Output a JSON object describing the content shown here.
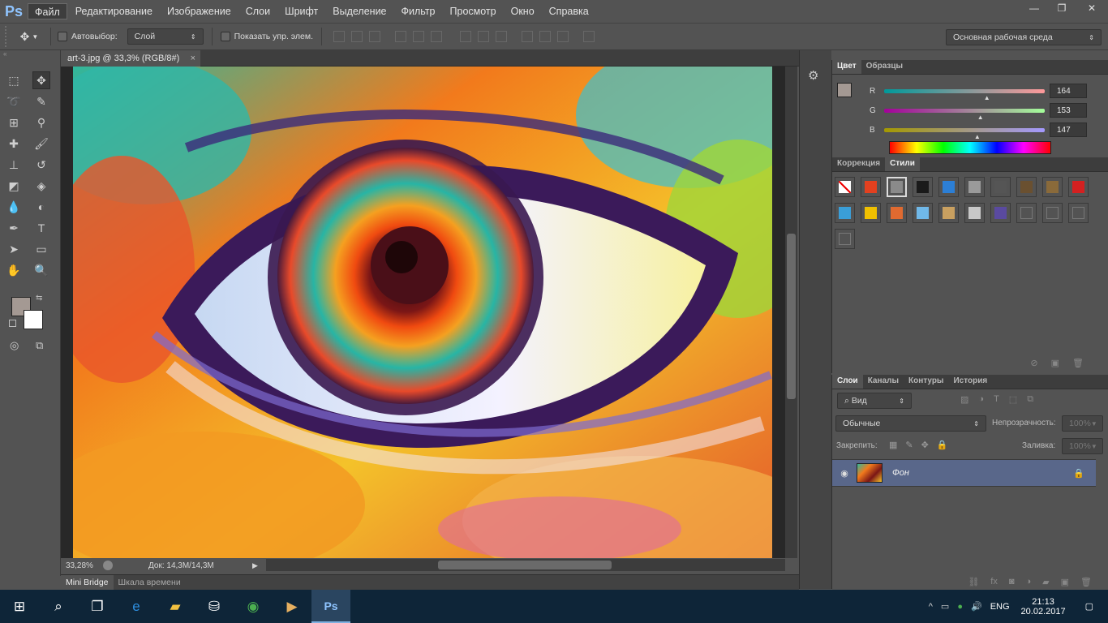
{
  "app": {
    "logo": "Ps"
  },
  "menu": [
    "Файл",
    "Редактирование",
    "Изображение",
    "Слои",
    "Шрифт",
    "Выделение",
    "Фильтр",
    "Просмотр",
    "Окно",
    "Справка"
  ],
  "window_controls": {
    "minimize": "—",
    "restore": "❐",
    "close": "✕"
  },
  "options": {
    "autoselect_label": "Автовыбор:",
    "autoselect_value": "Слой",
    "show_controls_label": "Показать упр. элем.",
    "workspace": "Основная рабочая среда"
  },
  "document": {
    "tab_title": "art-3.jpg @ 33,3% (RGB/8#)",
    "tab_close": "×",
    "zoom": "33,28%",
    "doc_info": "Док: 14,3M/14,3M"
  },
  "bottom_tabs": [
    "Mini Bridge",
    "Шкала времени"
  ],
  "color_panel": {
    "tabs": [
      "Цвет",
      "Образцы"
    ],
    "channels": [
      {
        "label": "R",
        "value": "164",
        "fraction": 0.64
      },
      {
        "label": "G",
        "value": "153",
        "fraction": 0.6
      },
      {
        "label": "B",
        "value": "147",
        "fraction": 0.58
      }
    ],
    "fg_color": "#a49993",
    "bg_color": "#ffffff"
  },
  "styles_panel": {
    "tabs": [
      "Коррекция",
      "Стили"
    ],
    "swatches": [
      "#ffffff",
      "#e3401f",
      "#8a8a8a",
      "#1a1a1a",
      "#2c7fd6",
      "#9a9a9a",
      "#555555",
      "#6a5030",
      "#8a6a3a",
      "#d42020",
      "#3a9ed8",
      "#f0c000",
      "#e06a30",
      "#70b8e8",
      "#c9a060",
      "#c8c8c8",
      "#5a4aa0",
      "#555555",
      "#555555",
      "#555555",
      "#555555"
    ]
  },
  "layers_panel": {
    "tabs": [
      "Слои",
      "Каналы",
      "Контуры",
      "История"
    ],
    "filter": "Вид",
    "blend_mode": "Обычные",
    "opacity_label": "Непрозрачность:",
    "opacity_value": "100%",
    "lock_label": "Закрепить:",
    "fill_label": "Заливка:",
    "fill_value": "100%",
    "layers": [
      {
        "name": "Фон"
      }
    ]
  },
  "taskbar": {
    "language": "ENG",
    "time": "21:13",
    "date": "20.02.2017"
  }
}
